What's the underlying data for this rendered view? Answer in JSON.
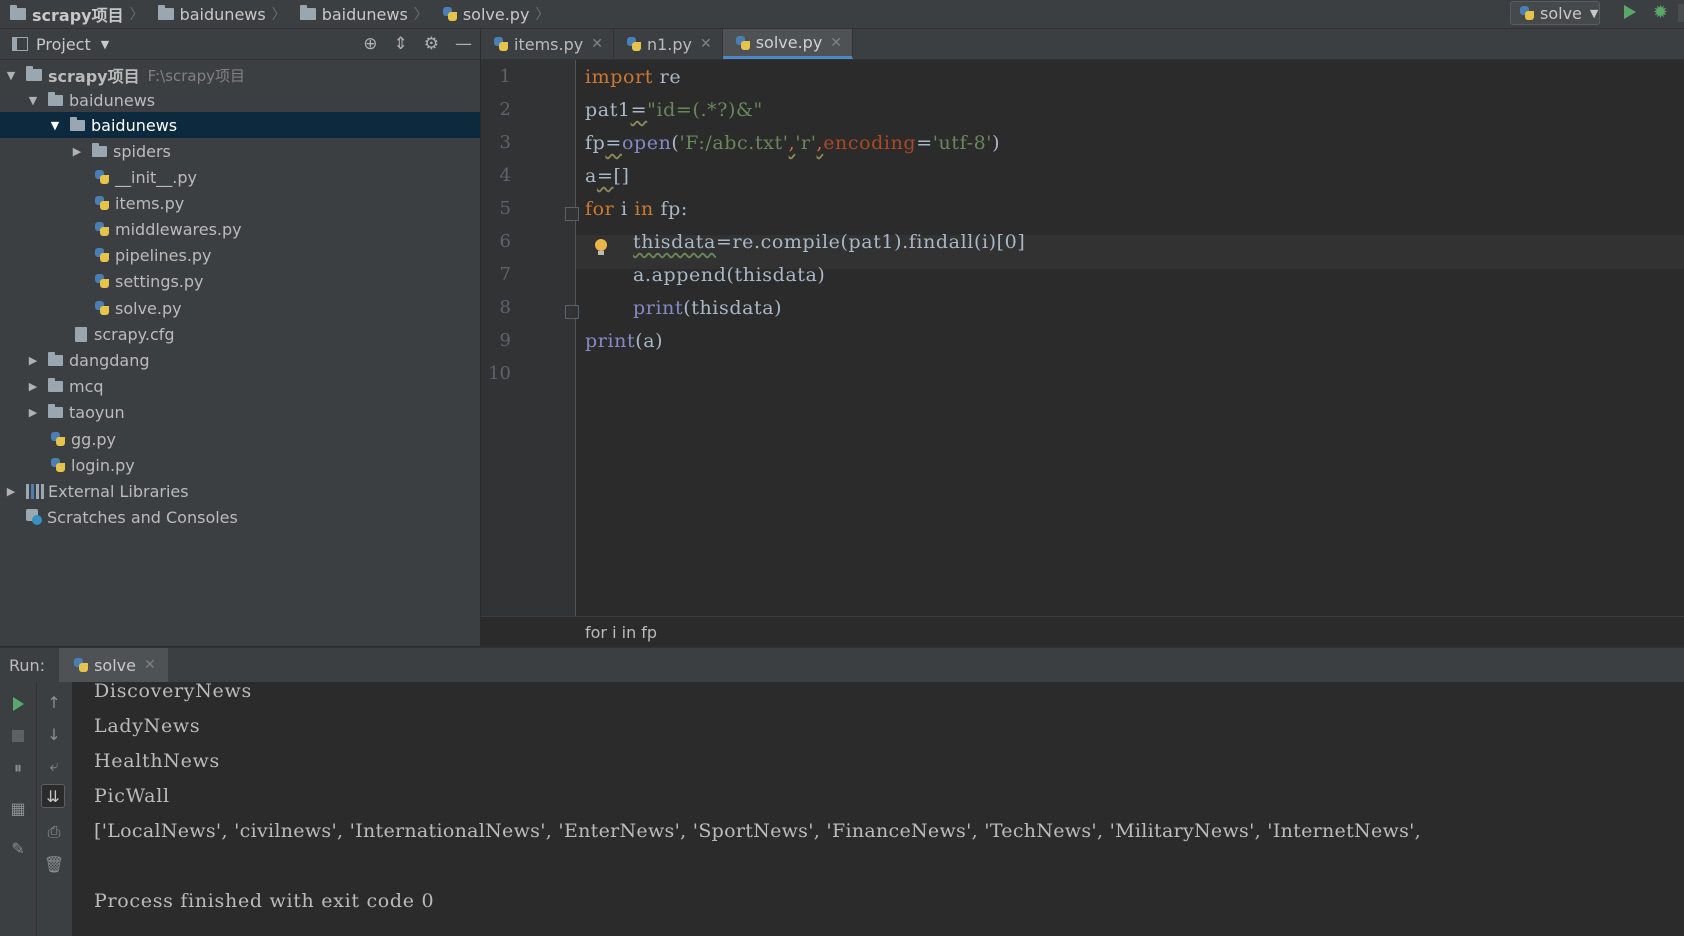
{
  "navbar": {
    "crumbs": [
      {
        "label": "scrapy项目"
      },
      {
        "label": "baidunews"
      },
      {
        "label": "baidunews"
      },
      {
        "label": "solve.py"
      }
    ],
    "run_config": "solve"
  },
  "project_panel": {
    "title": "Project",
    "tree": [
      {
        "label": "scrapy项目",
        "path": "F:\\scrapy项目"
      },
      {
        "label": "baidunews"
      },
      {
        "label": "baidunews"
      },
      {
        "label": "spiders"
      },
      {
        "label": "__init__.py"
      },
      {
        "label": "items.py"
      },
      {
        "label": "middlewares.py"
      },
      {
        "label": "pipelines.py"
      },
      {
        "label": "settings.py"
      },
      {
        "label": "solve.py"
      },
      {
        "label": "scrapy.cfg"
      },
      {
        "label": "dangdang"
      },
      {
        "label": "mcq"
      },
      {
        "label": "taoyun"
      },
      {
        "label": "gg.py"
      },
      {
        "label": "login.py"
      },
      {
        "label": "External Libraries"
      },
      {
        "label": "Scratches and Consoles"
      }
    ]
  },
  "editor": {
    "tabs": [
      {
        "label": "items.py"
      },
      {
        "label": "n1.py"
      },
      {
        "label": "solve.py"
      }
    ],
    "line_numbers": [
      "1",
      "2",
      "3",
      "4",
      "5",
      "6",
      "7",
      "8",
      "9",
      "10"
    ],
    "code": {
      "l1": {
        "kw": "import",
        "rest": " re"
      },
      "l2": {
        "a": "pat1",
        "b": "=",
        "s": "\"id=(.*?)&\""
      },
      "l3": {
        "a": "fp",
        "b": "=",
        "fn": "open",
        "p1": "(",
        "s1": "'F:/abc.txt'",
        "c1": ",",
        "s2": "'r'",
        "c2": ",",
        "kwarg": "encoding",
        "eq": "=",
        "s3": "'utf-8'",
        "p2": ")"
      },
      "l4": {
        "a": "a",
        "b": "=",
        "c": "[]"
      },
      "l5": {
        "kw1": "for",
        "v": " i ",
        "kw2": "in",
        "rest": " fp:"
      },
      "l6": {
        "a": "thisdata",
        "b": "=re.compile(pat1).findall(i)[0]"
      },
      "l7": {
        "a": "a.append(thisdata)"
      },
      "l8": {
        "fn": "print",
        "rest": "(thisdata)"
      },
      "l9": {
        "fn": "print",
        "rest": "(a)"
      }
    },
    "breadcrumb": "for i in fp"
  },
  "run_panel": {
    "label": "Run:",
    "tab": "solve",
    "output": [
      "DiscoveryNews",
      "LadyNews",
      "HealthNews",
      "PicWall",
      "['LocalNews', 'civilnews', 'InternationalNews', 'EnterNews', 'SportNews', 'FinanceNews', 'TechNews', 'MilitaryNews', 'InternetNews',",
      "",
      "Process finished with exit code 0"
    ]
  },
  "colors": {
    "keyword": "#cc7832",
    "string": "#6a8759",
    "builtin": "#8888c6",
    "kwarg": "#aa4926",
    "selection": "#0d293e",
    "tab_underline": "#4a88c7"
  }
}
